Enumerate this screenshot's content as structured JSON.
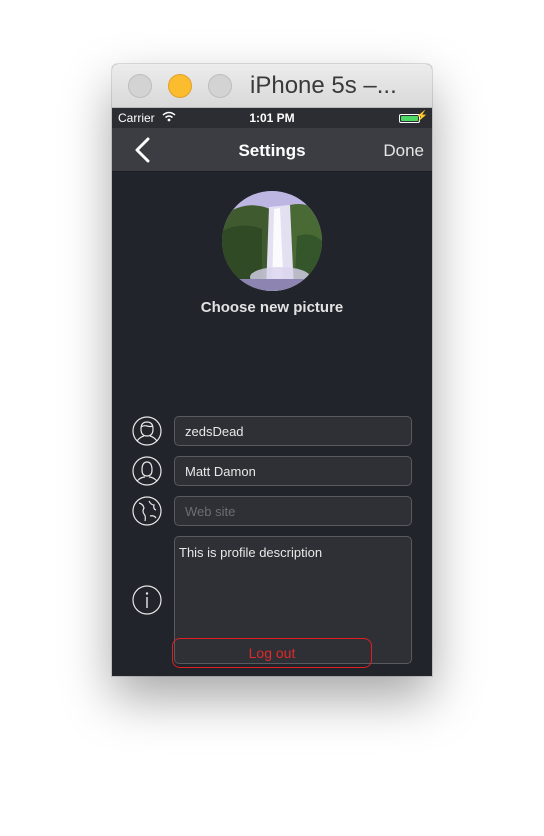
{
  "window": {
    "title": "iPhone 5s –..."
  },
  "status_bar": {
    "carrier": "Carrier",
    "time": "1:01 PM"
  },
  "nav_bar": {
    "title": "Settings",
    "done_label": "Done"
  },
  "profile": {
    "choose_picture_label": "Choose new picture"
  },
  "form": {
    "username": {
      "value": "zedsDead"
    },
    "full_name": {
      "value": "Matt Damon"
    },
    "website": {
      "value": "",
      "placeholder": "Web site"
    },
    "description": {
      "value": "This is profile description"
    }
  },
  "logout": {
    "label": "Log out"
  },
  "colors": {
    "background": "#22242b",
    "nav_bar": "#3b3d42",
    "field_border": "#585a60",
    "logout_red": "#e02020",
    "battery_green": "#4cd964"
  },
  "icons": [
    "back-chevron-icon",
    "user-icon",
    "person-icon",
    "globe-icon",
    "info-icon",
    "wifi-icon",
    "battery-icon"
  ]
}
